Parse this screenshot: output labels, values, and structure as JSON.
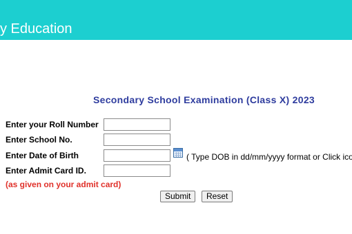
{
  "header": {
    "title": "y Education"
  },
  "form": {
    "title": "Secondary School Examination (Class X) 2023",
    "roll_number_label": "Enter your Roll Number",
    "roll_number_value": "",
    "school_no_label": "Enter School No.",
    "school_no_value": "",
    "dob_label": "Enter Date of Birth",
    "dob_value": "",
    "dob_hint": "( Type DOB in dd/mm/yyyy format or Click icon )",
    "admit_card_label": "Enter Admit Card ID.",
    "admit_card_value": "",
    "admit_card_note": "(as given on your admit card)",
    "submit_label": "Submit",
    "reset_label": "Reset"
  },
  "icons": {
    "calendar": "calendar-icon"
  },
  "colors": {
    "header_bg": "#1ccfd0",
    "title": "#2e3c9e",
    "note": "#e0312a"
  }
}
